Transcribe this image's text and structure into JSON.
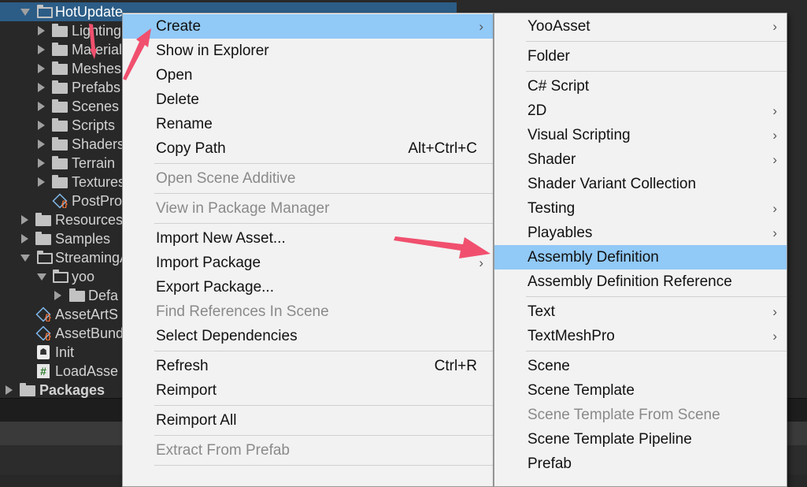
{
  "tree": {
    "items": [
      {
        "label": "HotUpdate",
        "kind": "folder-open",
        "arrow": "down"
      },
      {
        "label": "Lighting",
        "kind": "folder",
        "arrow": "right"
      },
      {
        "label": "Materials",
        "kind": "folder",
        "arrow": "right"
      },
      {
        "label": "Meshes",
        "kind": "folder",
        "arrow": "right"
      },
      {
        "label": "Prefabs",
        "kind": "folder",
        "arrow": "right"
      },
      {
        "label": "Scenes",
        "kind": "folder",
        "arrow": "right"
      },
      {
        "label": "Scripts",
        "kind": "folder",
        "arrow": "right"
      },
      {
        "label": "Shaders",
        "kind": "folder",
        "arrow": "right"
      },
      {
        "label": "Terrain",
        "kind": "folder",
        "arrow": "right"
      },
      {
        "label": "Textures",
        "kind": "folder",
        "arrow": "right"
      },
      {
        "label": "PostPro",
        "kind": "asset",
        "arrow": ""
      },
      {
        "label": "Resources",
        "kind": "folder",
        "arrow": "right"
      },
      {
        "label": "Samples",
        "kind": "folder",
        "arrow": "right"
      },
      {
        "label": "StreamingAssets",
        "kind": "folder-open",
        "arrow": "down"
      },
      {
        "label": "yoo",
        "kind": "folder-open",
        "arrow": "down"
      },
      {
        "label": "Defa",
        "kind": "folder",
        "arrow": "right"
      },
      {
        "label": "AssetArtS",
        "kind": "asset",
        "arrow": ""
      },
      {
        "label": "AssetBund",
        "kind": "asset",
        "arrow": ""
      },
      {
        "label": "Init",
        "kind": "scene",
        "arrow": ""
      },
      {
        "label": "LoadAsse",
        "kind": "script",
        "arrow": ""
      },
      {
        "label": "Packages",
        "kind": "folder",
        "arrow": "right"
      }
    ]
  },
  "context_menu": {
    "items": [
      {
        "label": "Create",
        "submenu": true,
        "highlighted": true
      },
      {
        "label": "Show in Explorer"
      },
      {
        "label": "Open"
      },
      {
        "label": "Delete"
      },
      {
        "label": "Rename"
      },
      {
        "label": "Copy Path",
        "shortcut": "Alt+Ctrl+C"
      },
      {
        "label": "Open Scene Additive",
        "disabled": true
      },
      {
        "label": "View in Package Manager",
        "disabled": true
      },
      {
        "label": "Import New Asset..."
      },
      {
        "label": "Import Package",
        "submenu": true
      },
      {
        "label": "Export Package..."
      },
      {
        "label": "Find References In Scene",
        "disabled": true
      },
      {
        "label": "Select Dependencies"
      },
      {
        "label": "Refresh",
        "shortcut": "Ctrl+R"
      },
      {
        "label": "Reimport"
      },
      {
        "label": "Reimport All"
      },
      {
        "label": "Extract From Prefab",
        "disabled": true
      }
    ]
  },
  "create_submenu": {
    "items": [
      {
        "label": "YooAsset",
        "submenu": true
      },
      {
        "label": "Folder"
      },
      {
        "label": "C# Script"
      },
      {
        "label": "2D",
        "submenu": true
      },
      {
        "label": "Visual Scripting",
        "submenu": true
      },
      {
        "label": "Shader",
        "submenu": true
      },
      {
        "label": "Shader Variant Collection"
      },
      {
        "label": "Testing",
        "submenu": true
      },
      {
        "label": "Playables",
        "submenu": true
      },
      {
        "label": "Assembly Definition",
        "highlighted": true
      },
      {
        "label": "Assembly Definition Reference"
      },
      {
        "label": "Text",
        "submenu": true
      },
      {
        "label": "TextMeshPro",
        "submenu": true
      },
      {
        "label": "Scene"
      },
      {
        "label": "Scene Template"
      },
      {
        "label": "Scene Template From Scene",
        "disabled": true
      },
      {
        "label": "Scene Template Pipeline"
      },
      {
        "label": "Prefab"
      }
    ]
  },
  "colors": {
    "highlight": "#91c9f7",
    "annotation_arrow": "#f0506e",
    "tree_selected": "#2c5d87"
  },
  "icons": {
    "submenu": "chevron-right-icon",
    "folder": "folder-icon",
    "asset": "asset-icon",
    "scene": "scene-icon",
    "script": "script-icon"
  }
}
